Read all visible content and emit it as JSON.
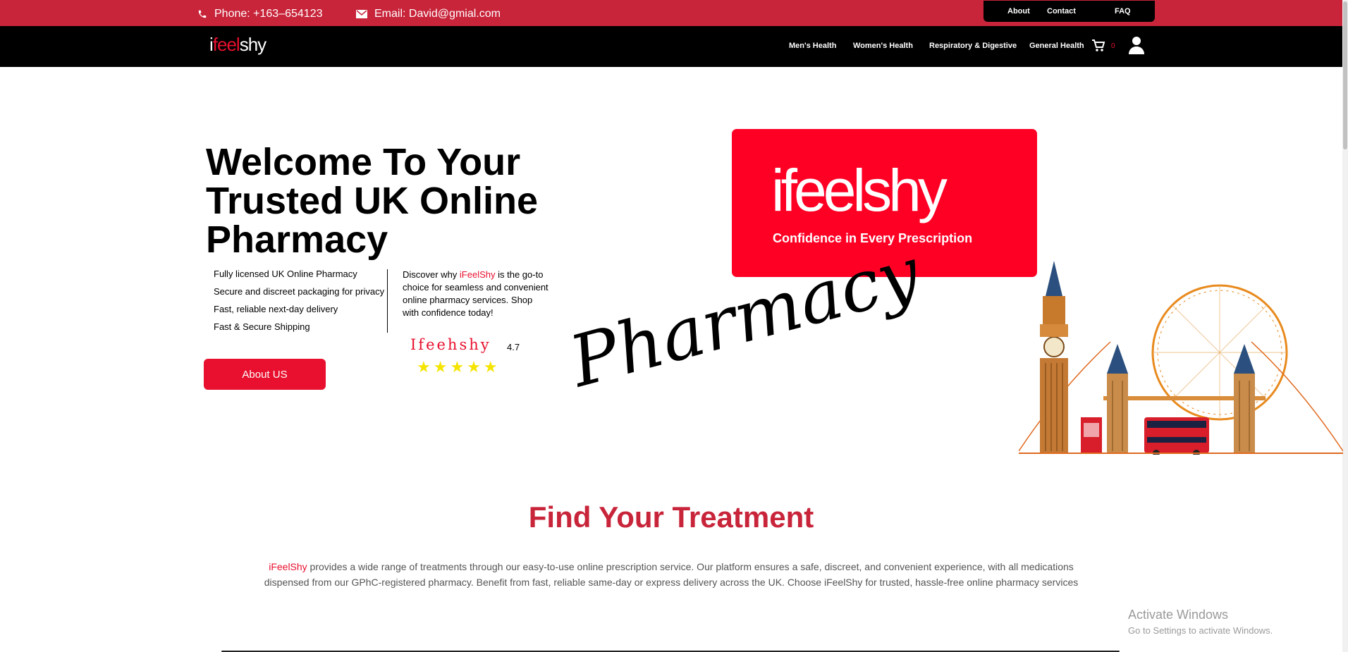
{
  "topbar": {
    "phone": "Phone: +163–654123",
    "email": "Email: David@gmial.com",
    "links": [
      "About",
      "Contact",
      "FAQ"
    ]
  },
  "nav": {
    "logo_left": "i",
    "logo_mid": "feel",
    "logo_right": "shy",
    "links": [
      "Men's Health",
      "Women's Health",
      "Respiratory & Digestive",
      "General Health"
    ],
    "cart_count": "0",
    "icons": [
      "phone-icon",
      "mail-icon",
      "cart-icon",
      "user-icon"
    ]
  },
  "hero": {
    "title": "Welcome To Your Trusted UK Online Pharmacy",
    "features": [
      "Fully licensed UK Online Pharmacy",
      "Secure and discreet packaging for privacy",
      "Fast, reliable next-day delivery",
      "Fast & Secure Shipping"
    ],
    "discover_pre": "Discover why ",
    "discover_brand": "iFeelShy",
    "discover_post": " is the go-to choice for seamless and convenient online pharmacy services. Shop with confidence today!",
    "rating_name": "Ifeehshy",
    "rating_value": "4.7",
    "stars": "★★★★★",
    "about_button": "About US",
    "brand_box_name": "ifeelshy",
    "brand_box_tagline": "Confidence in Every Prescription",
    "script_text": "Pharmacy"
  },
  "treatment": {
    "title": "Find Your Treatment",
    "brand": "iFeelShy",
    "text": " provides a wide range of treatments through our easy-to-use online prescription service. Our platform ensures a safe, discreet, and convenient experience, with all medications dispensed from our GPhC-registered pharmacy. Benefit from fast, reliable same-day or express delivery across the UK. Choose iFeelShy for trusted, hassle-free online pharmacy services"
  },
  "windows": {
    "line1": "Activate Windows",
    "line2": "Go to Settings to activate Windows."
  },
  "colors": {
    "topbar": "#c8243a",
    "brand_red": "#e8102e",
    "nav_bg": "#000000"
  }
}
